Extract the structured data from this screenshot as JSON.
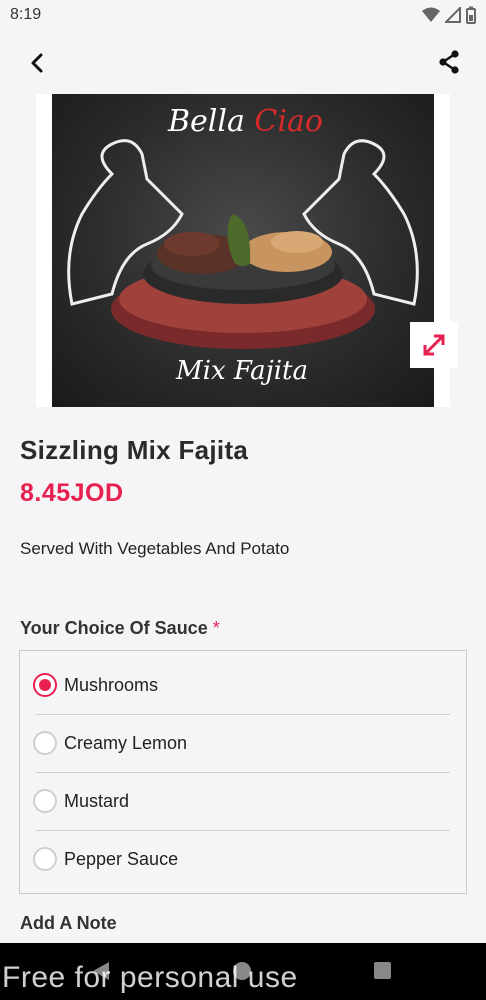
{
  "status_bar": {
    "time": "8:19"
  },
  "product": {
    "image_brand_lines": [
      "Bella ",
      "Ciao"
    ],
    "image_caption": "Mix Fajita",
    "title": "Sizzling Mix Fajita",
    "price": "8.45JOD",
    "description": "Served With Vegetables And Potato"
  },
  "sauce_section": {
    "title": "Your Choice Of Sauce",
    "required_mark": "*",
    "options": [
      {
        "label": "Mushrooms",
        "selected": true
      },
      {
        "label": "Creamy Lemon",
        "selected": false
      },
      {
        "label": "Mustard",
        "selected": false
      },
      {
        "label": "Pepper Sauce",
        "selected": false
      }
    ]
  },
  "note_section": {
    "title": "Add A Note"
  },
  "watermark": "Free for personal use",
  "colors": {
    "accent": "#e8204f",
    "background": "#f5f5f7",
    "navbar": "#000000"
  },
  "icons": {
    "back": "back-arrow-icon",
    "share": "share-icon",
    "expand": "expand-icon",
    "wifi": "wifi-icon",
    "signal": "signal-icon",
    "battery": "battery-icon"
  }
}
